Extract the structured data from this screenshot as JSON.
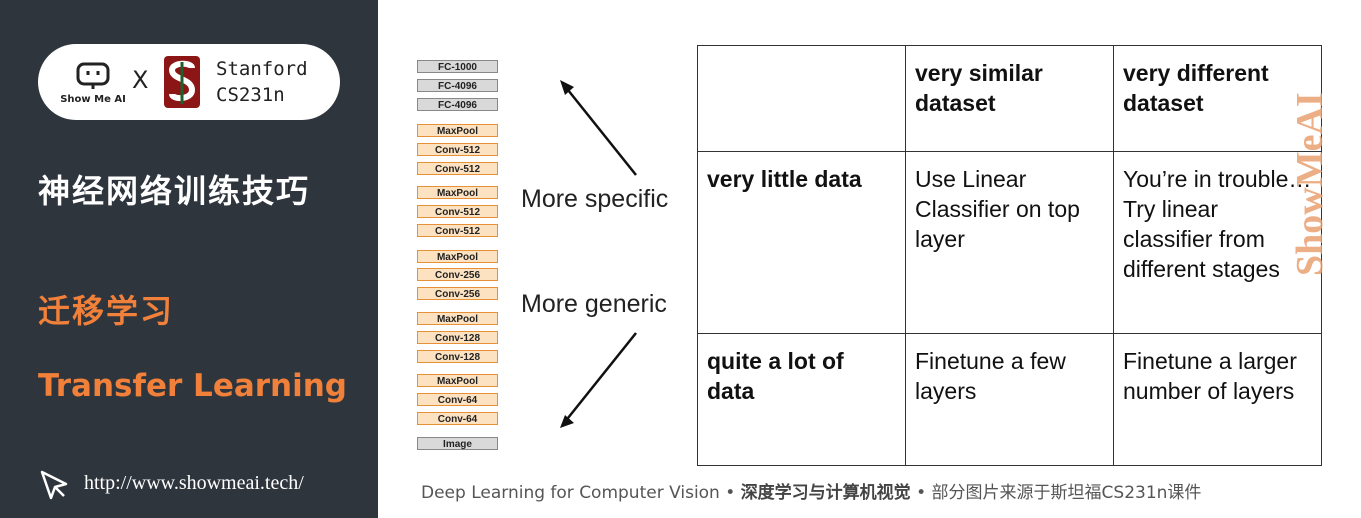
{
  "brand": {
    "showmeai_name": "Show Me AI",
    "x": "X",
    "stanford_line1": "Stanford",
    "stanford_line2": "CS231n"
  },
  "sidebar": {
    "title": "神经网络训练技巧",
    "subtitle_cn": "迁移学习",
    "subtitle_en": "Transfer Learning",
    "url": "http://www.showmeai.tech/"
  },
  "network_layers": [
    {
      "label": "FC-1000",
      "kind": "fc"
    },
    {
      "label": "FC-4096",
      "kind": "fc"
    },
    {
      "label": "FC-4096",
      "kind": "fc"
    },
    {
      "label": "MaxPool",
      "kind": "pool"
    },
    {
      "label": "Conv-512",
      "kind": "conv"
    },
    {
      "label": "Conv-512",
      "kind": "conv"
    },
    {
      "label": "MaxPool",
      "kind": "pool"
    },
    {
      "label": "Conv-512",
      "kind": "conv"
    },
    {
      "label": "Conv-512",
      "kind": "conv"
    },
    {
      "label": "MaxPool",
      "kind": "pool"
    },
    {
      "label": "Conv-256",
      "kind": "conv"
    },
    {
      "label": "Conv-256",
      "kind": "conv"
    },
    {
      "label": "MaxPool",
      "kind": "pool"
    },
    {
      "label": "Conv-128",
      "kind": "conv"
    },
    {
      "label": "Conv-128",
      "kind": "conv"
    },
    {
      "label": "MaxPool",
      "kind": "pool"
    },
    {
      "label": "Conv-64",
      "kind": "conv"
    },
    {
      "label": "Conv-64",
      "kind": "conv"
    },
    {
      "label": "Image",
      "kind": "img"
    }
  ],
  "arrows": {
    "specific": "More specific",
    "generic": "More generic"
  },
  "table": {
    "header": [
      "",
      "very similar dataset",
      "very different dataset"
    ],
    "rows": [
      {
        "label": "very little data",
        "similar": "Use Linear Classifier on top layer",
        "different": "You’re in trouble… Try linear classifier from different stages"
      },
      {
        "label": "quite a lot of data",
        "similar": "Finetune a few layers",
        "different": "Finetune a larger number of layers"
      }
    ]
  },
  "watermark": "ShowMeAI",
  "footer": {
    "en": "Deep Learning for Computer Vision",
    "sep": "•",
    "cn1": "深度学习与计算机视觉",
    "cn2": "部分图片来源于斯坦福CS231n课件"
  },
  "colors": {
    "sidebar_bg": "#2f353d",
    "accent": "#f0803a",
    "stanford": "#8c1515"
  }
}
